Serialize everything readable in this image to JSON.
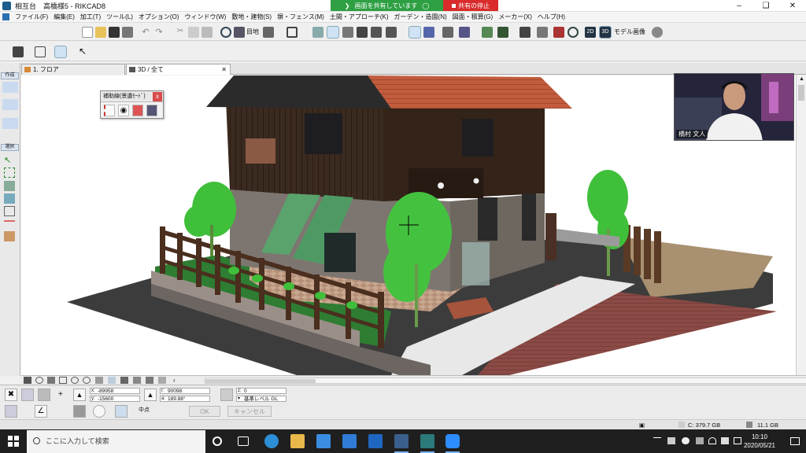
{
  "window": {
    "title": "相互台　高橋様5 - RIKCAD8"
  },
  "share": {
    "status": "画面を共有しています",
    "stop": "共有の停止"
  },
  "menu": [
    "ファイル(F)",
    "編集(E)",
    "加工(T)",
    "ツール(L)",
    "オプション(O)",
    "ウィンドウ(W)",
    "敷地・建物(S)",
    "塀・フェンス(M)",
    "土間・アプローチ(K)",
    "ガーデン・造園(N)",
    "図面・積算(G)",
    "メーカー(X)",
    "ヘルプ(H)"
  ],
  "toolbar": {
    "storey_label": "目地",
    "model_image": "モデル画像",
    "btn_2d": "2D",
    "btn_3d": "3D"
  },
  "palette": {
    "tag1": "作成",
    "tag2": "選択"
  },
  "tabs": [
    {
      "label": "1. フロア"
    },
    {
      "label": "3D / 全て"
    }
  ],
  "aux_panel": {
    "title": "補助線(景遺ﾓｰﾄﾞ)",
    "close": "x"
  },
  "video": {
    "name": "橋村 文人"
  },
  "input": {
    "x": "-89958",
    "y": "-15600",
    "r": "90098",
    "a": "189.88°",
    "z": "0",
    "ref_level": "基準レベル GL",
    "snap": "中点",
    "ok": "OK",
    "cancel": "キャンセル"
  },
  "status": {
    "c_drive": "C: 379.7 GB",
    "mem": "11.1 GB"
  },
  "taskbar": {
    "search_placeholder": "ここに入力して検索",
    "time": "10:10",
    "date": "2020/05/21"
  },
  "colors": {
    "accent": "#2ea043",
    "stop": "#d92b2b",
    "roof": "#c0573c",
    "wall": "#3a2a20",
    "plant": "#3fbf3a"
  }
}
